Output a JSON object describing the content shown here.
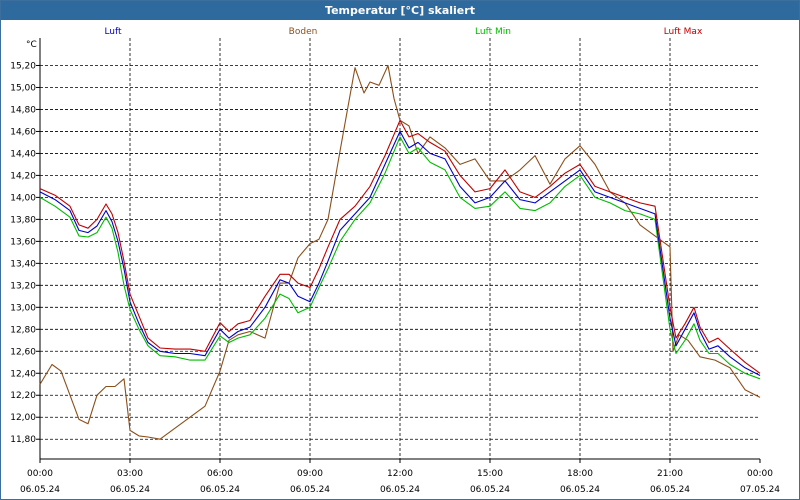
{
  "window": {
    "title": "Temperatur [°C] skaliert"
  },
  "colors": {
    "luft": "#0000c8",
    "boden": "#8b4f1a",
    "luft_min": "#00bb00",
    "luft_max": "#c00000",
    "titlebar": "#2f6a9f"
  },
  "chart_data": {
    "type": "line",
    "title": "Temperatur [°C] skaliert",
    "ylabel": "°C",
    "xlabel": "",
    "ylim": [
      11.62,
      15.45
    ],
    "xlim": [
      0,
      24
    ],
    "grid": true,
    "legend_position": "top",
    "yticks": [
      11.8,
      12.0,
      12.2,
      12.4,
      12.6,
      12.8,
      13.0,
      13.2,
      13.4,
      13.6,
      13.8,
      14.0,
      14.2,
      14.4,
      14.6,
      14.8,
      15.0,
      15.2
    ],
    "ytick_labels": [
      "11,80",
      "12,00",
      "12,20",
      "12,40",
      "12,60",
      "12,80",
      "13,00",
      "13,20",
      "13,40",
      "13,60",
      "13,80",
      "14,00",
      "14,20",
      "14,40",
      "14,60",
      "14,80",
      "15,00",
      "15,20"
    ],
    "xticks": [
      {
        "x": 0,
        "time": "00:00",
        "date": "06.05.24"
      },
      {
        "x": 3,
        "time": "03:00",
        "date": "06.05.24"
      },
      {
        "x": 6,
        "time": "06:00",
        "date": "06.05.24"
      },
      {
        "x": 9,
        "time": "09:00",
        "date": "06.05.24"
      },
      {
        "x": 12,
        "time": "12:00",
        "date": "06.05.24"
      },
      {
        "x": 15,
        "time": "15:00",
        "date": "06.05.24"
      },
      {
        "x": 18,
        "time": "18:00",
        "date": "06.05.24"
      },
      {
        "x": 21,
        "time": "21:00",
        "date": "06.05.24"
      },
      {
        "x": 24,
        "time": "00:00",
        "date": "07.05.24"
      }
    ],
    "series": [
      {
        "name": "Luft",
        "color": "#0000c8",
        "x": [
          0,
          0.5,
          1,
          1.3,
          1.6,
          1.9,
          2.2,
          2.4,
          2.6,
          2.8,
          3,
          3.3,
          3.6,
          4,
          4.5,
          5,
          5.5,
          6,
          6.3,
          6.6,
          7,
          7.5,
          8,
          8.3,
          8.6,
          9,
          9.3,
          9.6,
          10,
          10.5,
          11,
          11.5,
          12,
          12.3,
          12.6,
          13,
          13.5,
          14,
          14.5,
          15,
          15.5,
          16,
          16.5,
          17,
          17.5,
          18,
          18.5,
          19,
          19.5,
          20,
          20.5,
          21,
          21.2,
          21.5,
          21.8,
          22,
          22.3,
          22.6,
          23,
          23.5,
          24
        ],
        "y": [
          14.05,
          13.98,
          13.88,
          13.7,
          13.68,
          13.74,
          13.88,
          13.78,
          13.6,
          13.35,
          13.05,
          12.85,
          12.68,
          12.6,
          12.58,
          12.58,
          12.56,
          12.8,
          12.72,
          12.78,
          12.82,
          13.0,
          13.25,
          13.22,
          13.1,
          13.05,
          13.22,
          13.42,
          13.7,
          13.85,
          14.0,
          14.3,
          14.6,
          14.45,
          14.5,
          14.4,
          14.35,
          14.1,
          13.95,
          14.0,
          14.15,
          13.98,
          13.95,
          14.05,
          14.15,
          14.25,
          14.05,
          14.0,
          13.95,
          13.9,
          13.85,
          12.9,
          12.65,
          12.8,
          12.95,
          12.78,
          12.62,
          12.65,
          12.55,
          12.45,
          12.38
        ]
      },
      {
        "name": "Boden",
        "color": "#8b4f1a",
        "x": [
          0,
          0.4,
          0.7,
          1,
          1.3,
          1.6,
          1.9,
          2.2,
          2.5,
          2.8,
          3,
          3.3,
          3.6,
          4,
          4.5,
          5,
          5.5,
          6,
          6.3,
          6.6,
          7,
          7.5,
          8,
          8.3,
          8.6,
          9,
          9.3,
          9.6,
          10,
          10.5,
          10.8,
          11,
          11.3,
          11.6,
          11.8,
          12,
          12.3,
          12.6,
          13,
          13.5,
          14,
          14.5,
          15,
          15.5,
          16,
          16.5,
          17,
          17.5,
          18,
          18.5,
          19,
          19.5,
          20,
          20.5,
          21,
          21.1,
          21.3,
          21.6,
          22,
          22.5,
          23,
          23.5,
          24
        ],
        "y": [
          12.3,
          12.48,
          12.42,
          12.2,
          11.98,
          11.94,
          12.2,
          12.28,
          12.28,
          12.35,
          11.88,
          11.83,
          11.82,
          11.8,
          11.9,
          12.0,
          12.1,
          12.42,
          12.7,
          12.75,
          12.78,
          12.72,
          13.22,
          13.22,
          13.45,
          13.58,
          13.62,
          13.8,
          14.42,
          15.18,
          14.95,
          15.05,
          15.02,
          15.2,
          14.9,
          14.7,
          14.65,
          14.4,
          14.55,
          14.45,
          14.3,
          14.35,
          14.15,
          14.15,
          14.25,
          14.38,
          14.12,
          14.35,
          14.47,
          14.3,
          14.05,
          13.95,
          13.75,
          13.65,
          13.55,
          12.6,
          12.75,
          12.7,
          12.55,
          12.52,
          12.45,
          12.25,
          12.18
        ]
      },
      {
        "name": "Luft Min",
        "color": "#00bb00",
        "x": [
          0,
          0.5,
          1,
          1.3,
          1.6,
          1.9,
          2.2,
          2.4,
          2.6,
          2.8,
          3,
          3.3,
          3.6,
          4,
          4.5,
          5,
          5.5,
          6,
          6.3,
          6.6,
          7,
          7.5,
          8,
          8.3,
          8.6,
          9,
          9.3,
          9.6,
          10,
          10.5,
          11,
          11.5,
          12,
          12.3,
          12.6,
          13,
          13.5,
          14,
          14.5,
          15,
          15.5,
          16,
          16.5,
          17,
          17.5,
          18,
          18.5,
          19,
          19.5,
          20,
          20.5,
          21,
          21.2,
          21.5,
          21.8,
          22,
          22.3,
          22.6,
          23,
          23.5,
          24
        ],
        "y": [
          14.0,
          13.92,
          13.82,
          13.65,
          13.64,
          13.68,
          13.82,
          13.72,
          13.5,
          13.2,
          12.98,
          12.8,
          12.65,
          12.56,
          12.55,
          12.52,
          12.52,
          12.74,
          12.68,
          12.72,
          12.75,
          12.9,
          13.12,
          13.08,
          12.95,
          13.0,
          13.18,
          13.35,
          13.6,
          13.8,
          13.95,
          14.22,
          14.55,
          14.4,
          14.45,
          14.32,
          14.25,
          14.0,
          13.9,
          13.92,
          14.05,
          13.9,
          13.88,
          13.95,
          14.1,
          14.2,
          14.0,
          13.95,
          13.88,
          13.85,
          13.8,
          12.8,
          12.58,
          12.7,
          12.85,
          12.7,
          12.58,
          12.58,
          12.48,
          12.4,
          12.35
        ]
      },
      {
        "name": "Luft Max",
        "color": "#c00000",
        "x": [
          0,
          0.5,
          1,
          1.3,
          1.6,
          1.9,
          2.2,
          2.4,
          2.6,
          2.8,
          3,
          3.3,
          3.6,
          4,
          4.5,
          5,
          5.5,
          6,
          6.3,
          6.6,
          7,
          7.5,
          8,
          8.3,
          8.6,
          9,
          9.3,
          9.6,
          10,
          10.5,
          11,
          11.5,
          12,
          12.3,
          12.6,
          13,
          13.5,
          14,
          14.5,
          15,
          15.5,
          16,
          16.5,
          17,
          17.5,
          18,
          18.5,
          19,
          19.5,
          20,
          20.5,
          21,
          21.2,
          21.5,
          21.8,
          22,
          22.3,
          22.6,
          23,
          23.5,
          24
        ],
        "y": [
          14.08,
          14.02,
          13.92,
          13.75,
          13.72,
          13.8,
          13.94,
          13.85,
          13.68,
          13.42,
          13.12,
          12.92,
          12.72,
          12.63,
          12.62,
          12.62,
          12.6,
          12.86,
          12.78,
          12.85,
          12.88,
          13.1,
          13.3,
          13.3,
          13.22,
          13.18,
          13.35,
          13.55,
          13.8,
          13.92,
          14.1,
          14.38,
          14.7,
          14.55,
          14.58,
          14.5,
          14.42,
          14.2,
          14.05,
          14.08,
          14.25,
          14.05,
          14.0,
          14.1,
          14.22,
          14.3,
          14.1,
          14.05,
          14.0,
          13.95,
          13.92,
          13.0,
          12.72,
          12.85,
          13.0,
          12.82,
          12.68,
          12.72,
          12.62,
          12.5,
          12.4
        ]
      }
    ]
  }
}
